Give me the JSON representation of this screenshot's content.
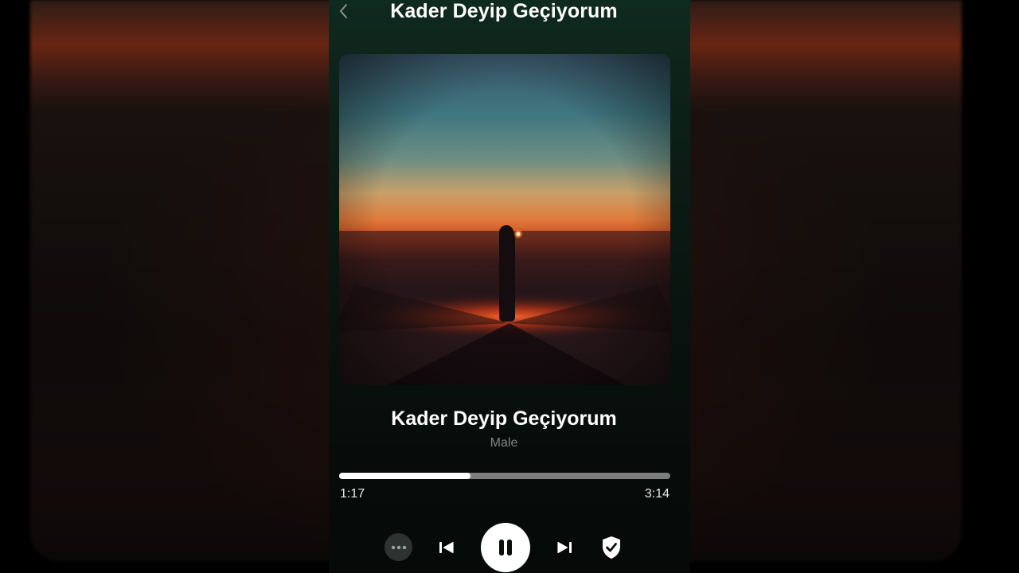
{
  "header": {
    "title": "Kader Deyip Geçiyorum"
  },
  "track": {
    "title": "Kader Deyip Geçiyorum",
    "artist": "Male",
    "elapsed": "1:17",
    "duration": "3:14",
    "progress_fraction": 0.397
  },
  "icons": {
    "back": "chevron-left-icon",
    "more": "more-dots-icon",
    "previous": "skip-previous-icon",
    "play_pause": "pause-icon",
    "next": "skip-next-icon",
    "shield": "shield-check-icon"
  },
  "colors": {
    "accent_bg": "#0c1d16",
    "progress_fill": "#ffffff",
    "progress_track": "#7c7f7e",
    "artist_text": "#7d8581"
  }
}
